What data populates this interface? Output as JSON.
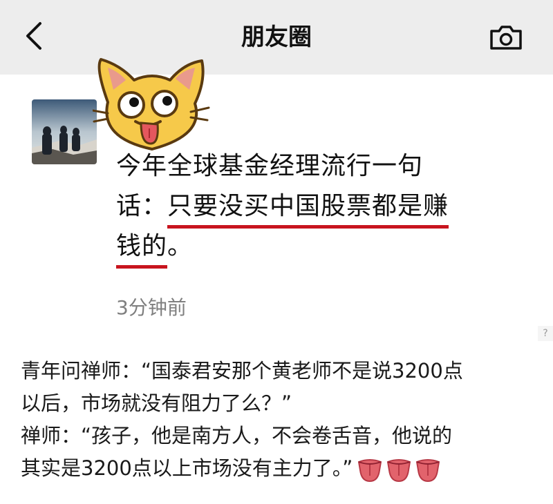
{
  "navbar": {
    "title": "朋友圈",
    "back_icon": "chevron-left-icon",
    "camera_icon": "camera-icon",
    "background": "#ededed"
  },
  "post": {
    "line1": "今年全球基金经理流行一句",
    "line2_prefix": "话：",
    "line2_underlined": "只要没买中国股票都是赚",
    "line3_underlined": "钱的",
    "line3_suffix": "。",
    "timestamp": "3分钟前",
    "underline_color": "#c8141e",
    "sticker_icon": "cat-tongue-sticker"
  },
  "corner_mark": "?",
  "joke": {
    "line1": "青年问禅师：“国泰君安那个黄老师不是说3200点",
    "line2": "以后，市场就没有阻力了么？”",
    "line3": "禅师：“孩子，他是南方人，不会卷舌音，他说的",
    "line4": "其实是3200点以上市场没有主力了。”",
    "emoji_icon": "tongue-emoji"
  }
}
